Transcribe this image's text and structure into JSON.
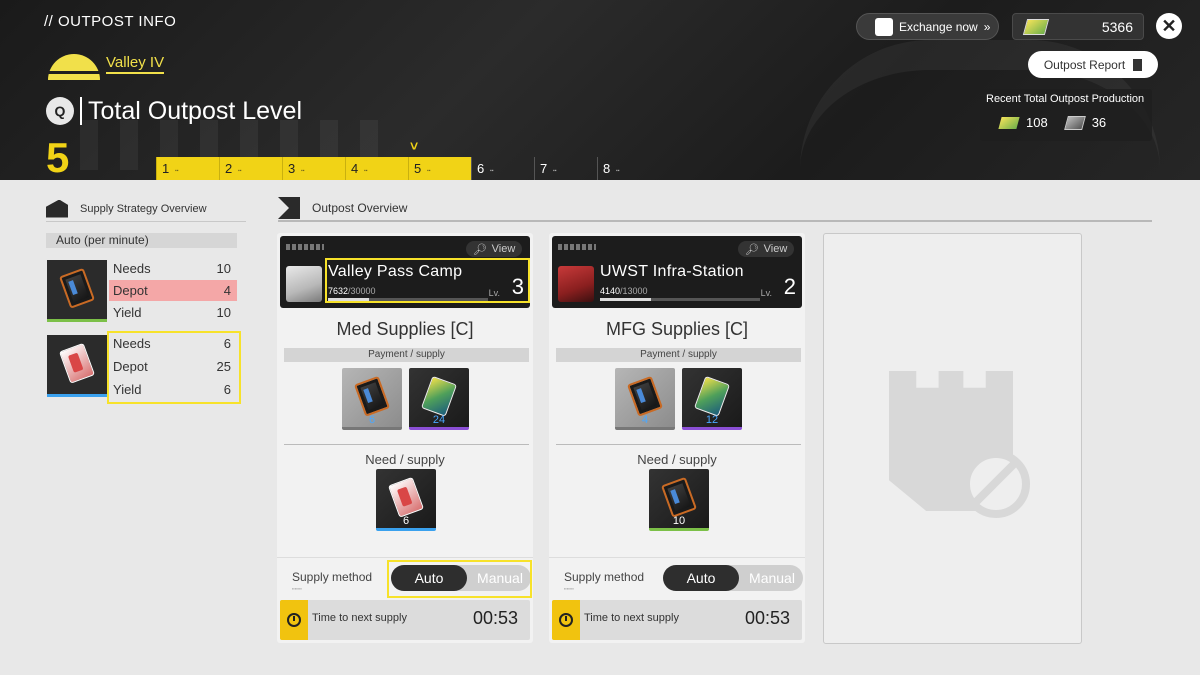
{
  "header": {
    "title": "// OUTPOST INFO",
    "region": "Valley IV",
    "total_level_icon": "Q",
    "total_level_title": "Total Outpost Level",
    "total_level_value": "5",
    "level_marker": "˅",
    "level_segments": [
      "1",
      "2",
      "3",
      "4",
      "5",
      "6",
      "7",
      "8"
    ],
    "level_filled": 5,
    "exchange_label": "Exchange now",
    "exchange_arrows": "»",
    "currency_value": "5366",
    "close_symbol": "✕",
    "report_label": "Outpost Report",
    "recent_label": "Recent Total Outpost Production",
    "recent_values": [
      "108",
      "36"
    ]
  },
  "supply_overview": {
    "title": "Supply Strategy Overview",
    "mode": "Auto (per minute)",
    "rows": [
      {
        "needs_label": "Needs",
        "needs": "10",
        "depot_label": "Depot",
        "depot": "4",
        "yield_label": "Yield",
        "yield": "10"
      },
      {
        "needs_label": "Needs",
        "needs": "6",
        "depot_label": "Depot",
        "depot": "25",
        "yield_label": "Yield",
        "yield": "6"
      }
    ]
  },
  "outpost_overview": {
    "title": "Outpost Overview",
    "cards": [
      {
        "view_label": "View",
        "name": "Valley Pass Camp",
        "xp_current": "7632",
        "xp_max": "/30000",
        "xp_fraction": 0.2544,
        "lv_label": "Lv.",
        "level": "3",
        "goods": "Med Supplies [C]",
        "payment_label": "Payment / supply",
        "payment_qty": [
          "6",
          "24"
        ],
        "need_label": "Need / supply",
        "need_qty": "6",
        "method_label": "Supply method",
        "auto_label": "Auto",
        "manual_label": "Manual",
        "next_label": "Time to next supply",
        "next_time": "00:53"
      },
      {
        "view_label": "View",
        "name": "UWST Infra-Station",
        "xp_current": "4140",
        "xp_max": "/13000",
        "xp_fraction": 0.3185,
        "lv_label": "Lv.",
        "level": "2",
        "goods": "MFG Supplies [C]",
        "payment_label": "Payment / supply",
        "payment_qty": [
          "4",
          "12"
        ],
        "need_label": "Need / supply",
        "need_qty": "10",
        "method_label": "Supply method",
        "auto_label": "Auto",
        "manual_label": "Manual",
        "next_label": "Time to next supply",
        "next_time": "00:53"
      }
    ]
  },
  "colors": {
    "accent_yellow": "#f1d316",
    "highlight": "#f7e22a",
    "depot_warning": "#f4a7a7"
  },
  "icons": [
    "exchange-icon",
    "gem-icon",
    "close-icon",
    "document-icon",
    "search-icon",
    "clock-icon",
    "battery-icon",
    "med-kit-icon",
    "gold-crystal-icon",
    "tower-locked-icon"
  ]
}
